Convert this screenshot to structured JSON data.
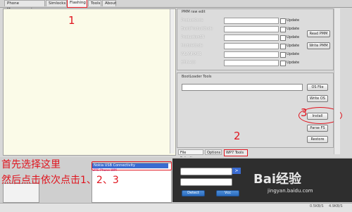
{
  "tabs": [
    "Phone Management",
    "Simlocks",
    "Flashing",
    "Tools",
    "About"
  ],
  "pmm": {
    "title": "PMM raw edit",
    "rows": [
      {
        "label": "ProductCode",
        "update": "Update"
      },
      {
        "label": "BasicProductCode",
        "update": "Update"
      },
      {
        "label": "ProductionSN",
        "update": "Update"
      },
      {
        "label": "ModuleCode",
        "update": "Update"
      },
      {
        "label": "WLANMAC1",
        "update": "Update"
      },
      {
        "label": "BTMAC0",
        "update": "Update"
      }
    ],
    "read_btn": "Read PMM",
    "write_btn": "Write PMM"
  },
  "bootloader": {
    "title": "BootLoader Tools",
    "os_file": "OS File",
    "write_os": "Write OS",
    "install": "Install",
    "parse_fs": "Parse FS",
    "restore": "Restore"
  },
  "subtabs": [
    "File Selection",
    "Options",
    "WP7 Tools"
  ],
  "annotations": {
    "num1": "1",
    "num2": "2",
    "num3": "3",
    "line1": "首先选择这里",
    "line2": "然后点击依次点击1、2、3"
  },
  "listbox": {
    "selected": "Nokia USB Connectivity",
    "sub": "ZTE Phone WM"
  },
  "bottom": {
    "detect": "Detect",
    "vcc": "Vcc",
    "watermark": "Bai经验",
    "watermark_url": "jingyan.baidu.com"
  },
  "status": {
    "left": "0.5KB/S",
    "right": "4.9KB/S"
  }
}
